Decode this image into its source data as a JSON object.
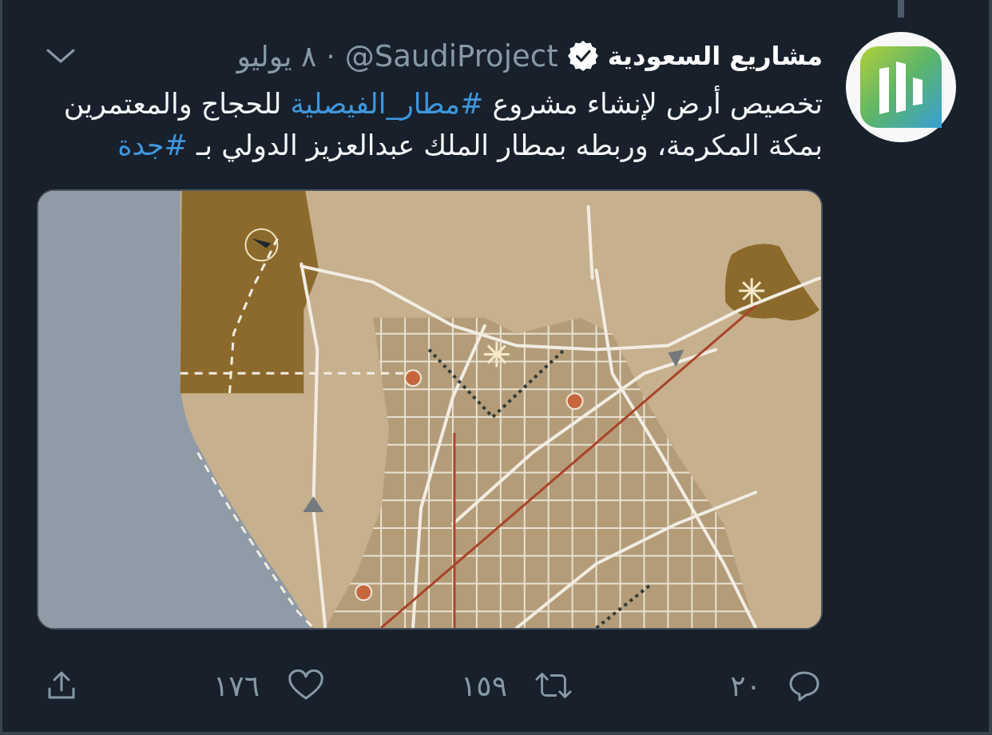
{
  "thread": {
    "line_above": true
  },
  "tweet": {
    "author": {
      "name": "مشاريع السعودية",
      "verified": true,
      "handle": "@SaudiProject"
    },
    "separator": "·",
    "date": "٨ يوليو",
    "lines": [
      [
        {
          "kind": "text",
          "text": "تخصيص أرض لإنشاء مشروع "
        },
        {
          "kind": "hashtag",
          "text": "#مطار_الفيصلية"
        },
        {
          "kind": "text",
          "text": " للحجاج والمعتمرين"
        }
      ],
      [
        {
          "kind": "text",
          "text": "بمكة المكرمة، وربطه بمطار الملك عبدالعزيز الدولي بـ "
        },
        {
          "kind": "hashtag",
          "text": "#جدة"
        }
      ]
    ],
    "media": {
      "kind": "map"
    }
  },
  "actions": [
    {
      "kind": "reply",
      "count": "٢٠"
    },
    {
      "kind": "retweet",
      "count": "١٥٩"
    },
    {
      "kind": "like",
      "count": "١٧٦"
    },
    {
      "kind": "share"
    }
  ]
}
